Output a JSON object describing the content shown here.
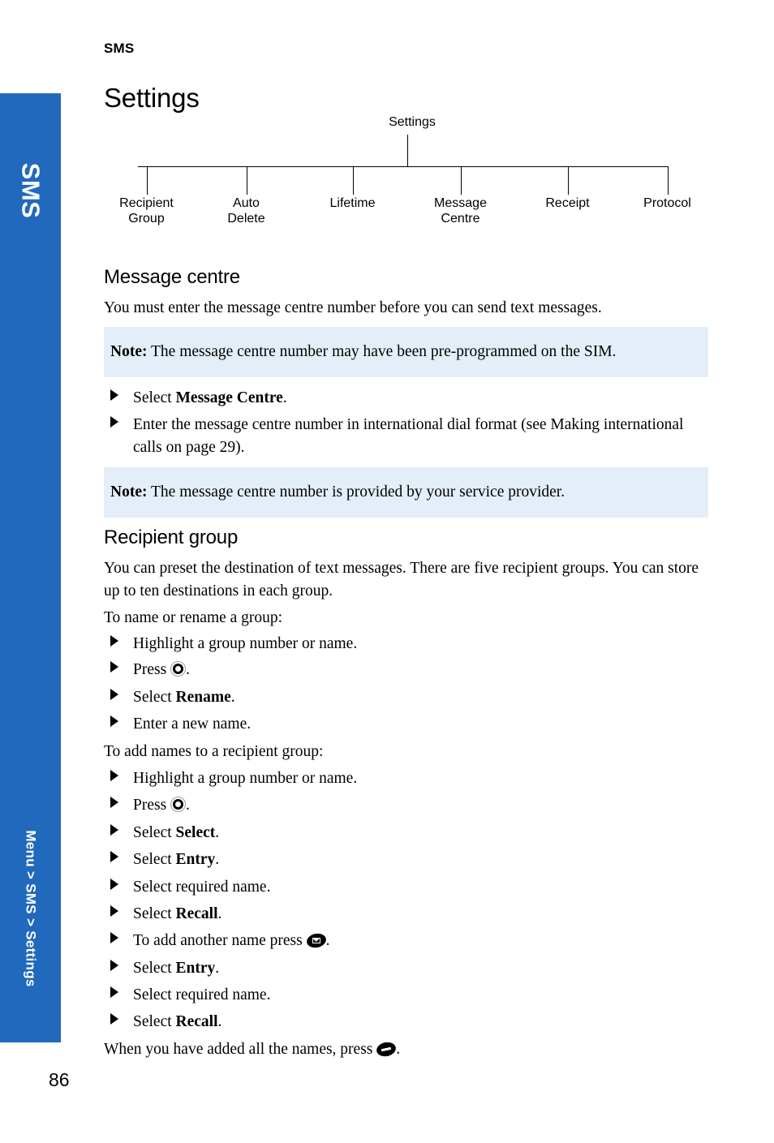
{
  "sidebar": {
    "chapter_label": "SMS",
    "path_label": "Menu > SMS > Settings",
    "color": "#2169bc"
  },
  "header": {
    "running_head": "SMS",
    "page_title": "Settings"
  },
  "diagram": {
    "root": "Settings",
    "leaves": [
      {
        "line1": "Recipient",
        "line2": "Group"
      },
      {
        "line1": "Auto",
        "line2": "Delete"
      },
      {
        "line1": "Lifetime",
        "line2": ""
      },
      {
        "line1": "Message",
        "line2": "Centre"
      },
      {
        "line1": "Receipt",
        "line2": ""
      },
      {
        "line1": "Protocol",
        "line2": ""
      }
    ]
  },
  "sections": {
    "message_centre": {
      "heading": "Message centre",
      "intro": "You must enter the message centre number before you can send text messages.",
      "note_1_label": "Note:",
      "note_1_text": " The message centre number may have been pre-programmed on the SIM.",
      "step_1_pre": "Select ",
      "step_1_bold": "Message Centre",
      "step_1_post": ".",
      "step_2": "Enter the message centre number in international dial format (see Making international calls on page 29).",
      "note_2_label": "Note:",
      "note_2_text": " The message centre number is provided by your service provider."
    },
    "recipient_group": {
      "heading": "Recipient group",
      "intro": "You can preset the destination of text messages. There are five recipient groups. You can store up to ten destinations in each group.",
      "lead_in_1": "To name or rename a group:",
      "steps_1": [
        {
          "pre": "Highlight a group number or name.",
          "bold": "",
          "post": ""
        },
        {
          "pre": "Press ",
          "bold": "",
          "post": ".",
          "icon": "nav-key-icon"
        },
        {
          "pre": "Select ",
          "bold": "Rename",
          "post": "."
        },
        {
          "pre": "Enter a new name.",
          "bold": "",
          "post": ""
        }
      ],
      "lead_in_2": "To add names to a recipient group:",
      "steps_2": [
        {
          "pre": "Highlight a group number or name.",
          "bold": "",
          "post": ""
        },
        {
          "pre": "Press ",
          "bold": "",
          "post": ".",
          "icon": "nav-key-icon"
        },
        {
          "pre": "Select ",
          "bold": "Select",
          "post": "."
        },
        {
          "pre": "Select ",
          "bold": "Entry",
          "post": "."
        },
        {
          "pre": "Select required name.",
          "bold": "",
          "post": ""
        },
        {
          "pre": "Select ",
          "bold": "Recall",
          "post": "."
        },
        {
          "pre": "To add another name press ",
          "bold": "",
          "post": ".",
          "icon": "envelope-key-icon"
        },
        {
          "pre": "Select ",
          "bold": "Entry",
          "post": "."
        },
        {
          "pre": "Select required name.",
          "bold": "",
          "post": ""
        },
        {
          "pre": "Select ",
          "bold": "Recall",
          "post": "."
        }
      ],
      "closing_pre": "When you have added all the names, press ",
      "closing_post": "."
    }
  },
  "footer": {
    "page_number": "86"
  }
}
